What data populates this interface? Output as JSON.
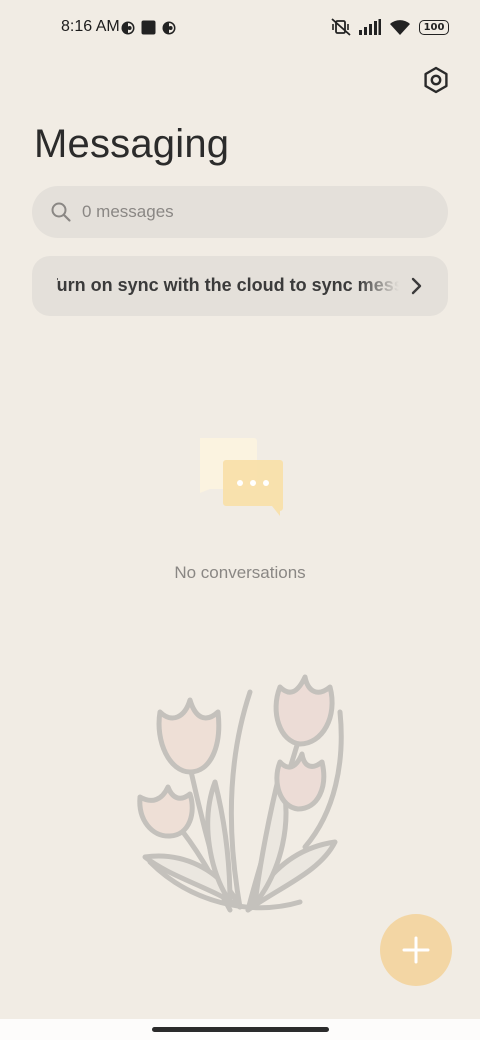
{
  "status_bar": {
    "time": "8:16 AM",
    "left_icons": [
      "notification-icon",
      "stop-icon",
      "notification-icon"
    ],
    "right_icons": [
      "mute-vibrate-icon",
      "cellular-signal-icon",
      "wifi-icon"
    ],
    "battery": "100"
  },
  "header": {
    "title": "Messaging",
    "settings_icon": "settings-icon"
  },
  "search": {
    "icon": "search-icon",
    "placeholder": "0 messages"
  },
  "sync_banner": {
    "text": "Turn on sync with the cloud to sync messages",
    "icon": "chevron-right-icon"
  },
  "empty_state": {
    "icon": "chat-bubbles-icon",
    "text": "No conversations"
  },
  "wallpaper": {
    "icon": "tulips-illustration"
  },
  "fab": {
    "icon": "plus-icon",
    "color": "#f3d6a4"
  },
  "colors": {
    "background": "#f1ece4",
    "card": "#e4e0da",
    "accent": "#f3d6a4"
  }
}
